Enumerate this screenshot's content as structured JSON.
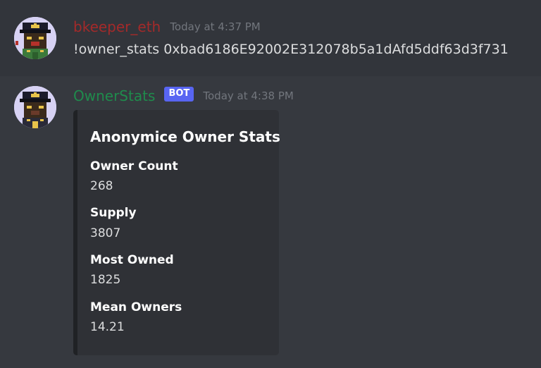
{
  "messages": [
    {
      "author": "bkeeper_eth",
      "author_color": "#a32a2a",
      "timestamp": "Today at 4:37 PM",
      "text": "!owner_stats 0xbad6186E92002E312078b5a1dAfd5ddf63d3f731",
      "avatar": "anonymouse-avatar"
    },
    {
      "author": "OwnerStats",
      "author_color": "#1f8b4c",
      "bot_tag": "BOT",
      "timestamp": "Today at 4:38 PM",
      "avatar": "anonymouse-avatar",
      "embed": {
        "title": "Anonymice Owner Stats",
        "fields": [
          {
            "name": "Owner Count",
            "value": "268"
          },
          {
            "name": "Supply",
            "value": "3807"
          },
          {
            "name": "Most Owned",
            "value": "1825"
          },
          {
            "name": "Mean Owners",
            "value": "14.21"
          }
        ]
      }
    }
  ],
  "colors": {
    "background": "#36393f",
    "hover_background": "#32353b",
    "embed_background": "#2f3136",
    "embed_border": "#202225",
    "bot_tag": "#5865f2"
  }
}
